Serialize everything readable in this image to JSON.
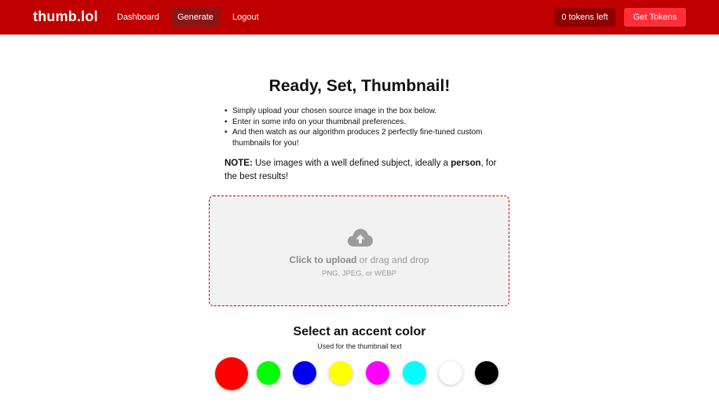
{
  "navbar": {
    "brand": "thumb.lol",
    "links": [
      "Dashboard",
      "Generate",
      "Logout"
    ],
    "active_link": "Generate",
    "tokens_label": "0 tokens left",
    "get_tokens_label": "Get Tokens"
  },
  "main": {
    "title": "Ready, Set, Thumbnail!",
    "bullets": [
      "Simply upload your chosen source image in the box below.",
      "Enter in some info on your thumbnail preferences.",
      "And then watch as our algorithm produces 2 perfectly fine-tuned custom thumbnails for you!"
    ],
    "note_label": "NOTE:",
    "note_text_1": " Use images with a well defined subject, ideally a ",
    "note_bold": "person",
    "note_text_2": ", for the best results!"
  },
  "upload": {
    "icon": "cloud-upload-icon",
    "click_text": "Click to upload",
    "drag_text": " or drag and drop",
    "formats": "PNG, JPEG, or WEBP"
  },
  "accent": {
    "title": "Select an accent color",
    "subtitle": "Used for the thumbnail text",
    "selected": "red",
    "colors": [
      {
        "name": "red",
        "hex": "#ff0000"
      },
      {
        "name": "green",
        "hex": "#00ff00"
      },
      {
        "name": "blue",
        "hex": "#0000ee"
      },
      {
        "name": "yellow",
        "hex": "#ffff00"
      },
      {
        "name": "magenta",
        "hex": "#ff00ff"
      },
      {
        "name": "cyan",
        "hex": "#00ffff"
      },
      {
        "name": "white",
        "hex": "#ffffff"
      },
      {
        "name": "black",
        "hex": "#000000"
      }
    ]
  }
}
